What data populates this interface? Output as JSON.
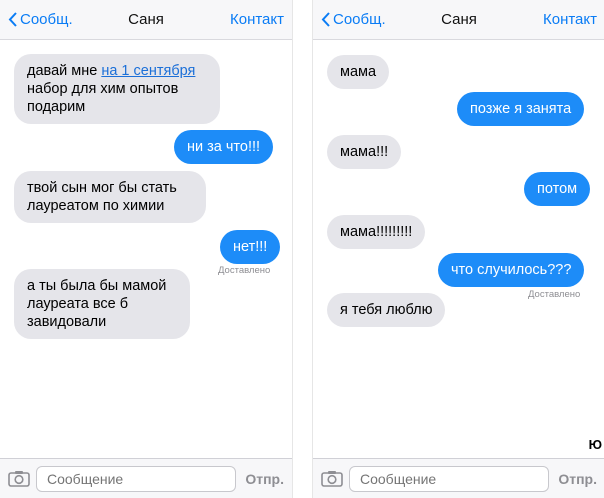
{
  "left": {
    "nav": {
      "back": "Сообщ.",
      "title": "Саня",
      "contact": "Контакт"
    },
    "messages": {
      "m1_pre": "давай мне ",
      "m1_link": "на 1 сентября",
      "m1_post": "набор для хим опытов подарим",
      "m2": "ни за что!!!",
      "m3": "твой сын мог бы стать лауреатом по химии",
      "m4": "нет!!!",
      "m5": "а ты была бы мамой лауреата все б завидовали"
    },
    "delivered": "Доставлено",
    "input": {
      "placeholder": "Сообщение",
      "send": "Отпр."
    }
  },
  "right": {
    "nav": {
      "back": "Сообщ.",
      "title": "Саня",
      "contact": "Контакт"
    },
    "messages": {
      "m1": "мама",
      "m2": "позже я занята",
      "m3": "мама!!!",
      "m4": "потом",
      "m5": "мама!!!!!!!!!",
      "m6": "что случилось???",
      "m7": "я тебя люблю"
    },
    "delivered": "Доставлено",
    "input": {
      "placeholder": "Сообщение",
      "send": "Отпр."
    }
  },
  "watermark": "Ю"
}
